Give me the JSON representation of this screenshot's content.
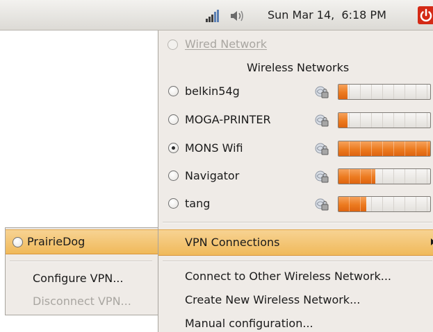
{
  "panel": {
    "clock": "Sun Mar 14,  6:18 PM",
    "icons": [
      "signal-strength-icon",
      "volume-icon",
      "power-icon"
    ],
    "power_color": "#d42a16"
  },
  "menu": {
    "wired_network": "Wired Network",
    "wireless_header": "Wireless Networks",
    "networks": [
      {
        "name": "belkin54g",
        "signal_percent": 10,
        "selected": false,
        "secured": true
      },
      {
        "name": "MOGA-PRINTER",
        "signal_percent": 10,
        "selected": false,
        "secured": true
      },
      {
        "name": "MONS Wifi",
        "signal_percent": 100,
        "selected": true,
        "secured": true
      },
      {
        "name": "Navigator",
        "signal_percent": 40,
        "selected": false,
        "secured": true
      },
      {
        "name": "tang",
        "signal_percent": 30,
        "selected": false,
        "secured": true
      }
    ],
    "vpn_connections": "VPN Connections",
    "connect_other": "Connect to Other Wireless Network...",
    "create_new": "Create New Wireless Network...",
    "manual_config": "Manual configuration..."
  },
  "vpn_menu": {
    "connection": "PrairieDog",
    "configure": "Configure VPN...",
    "disconnect": "Disconnect VPN..."
  },
  "colors": {
    "highlight": "#f0b95a",
    "signal_bar": "#ec7a1f",
    "menu_background": "#efebe7"
  }
}
